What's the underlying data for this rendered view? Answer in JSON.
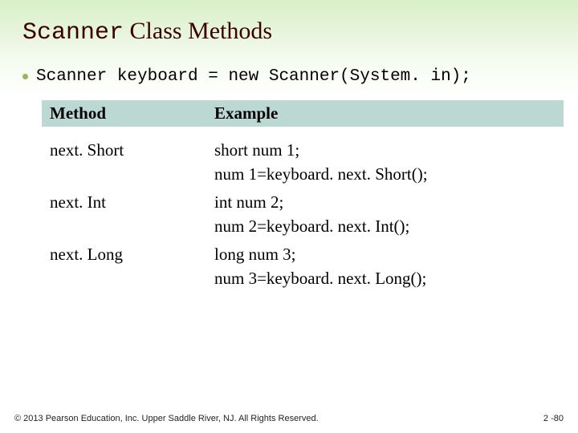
{
  "title": {
    "mono": "Scanner",
    "rest": " Class Methods"
  },
  "bullet": "Scanner keyboard = new Scanner(System. in);",
  "table": {
    "headers": {
      "col1": "Method",
      "col2": "Example"
    },
    "rows": [
      {
        "method": "next. Short",
        "example": [
          "short num 1;",
          "num 1=keyboard. next. Short();"
        ]
      },
      {
        "method": "next. Int",
        "example": [
          "int num 2;",
          "num 2=keyboard. next. Int();"
        ]
      },
      {
        "method": "next. Long",
        "example": [
          "long num 3;",
          "num 3=keyboard. next. Long();"
        ]
      }
    ]
  },
  "footer": {
    "copyright": "© 2013 Pearson Education, Inc. Upper Saddle River, NJ. All Rights Reserved.",
    "page": "2 -80"
  }
}
